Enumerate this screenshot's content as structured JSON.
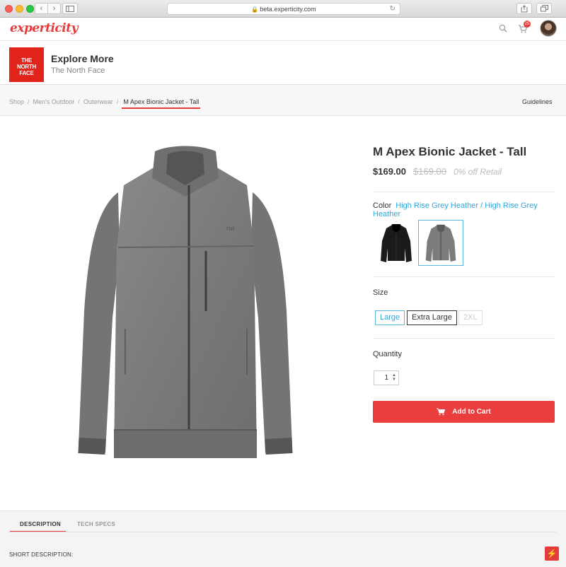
{
  "browser": {
    "url": "beta.experticity.com",
    "back_icon": "chevron-left-icon",
    "forward_icon": "chevron-right-icon"
  },
  "header": {
    "logo_text": "experticity",
    "cart_count": "25",
    "brand_color": "#e43c3c"
  },
  "brand": {
    "title": "Explore More",
    "subtitle": "The North Face",
    "logo_text": "THE NORTH FACE"
  },
  "breadcrumb": {
    "items": [
      "Shop",
      "Men's Outdoor",
      "Outerwear"
    ],
    "current": "M Apex Bionic Jacket - Tall",
    "guidelines_label": "Guidelines"
  },
  "product": {
    "title": "M Apex Bionic Jacket - Tall",
    "price": "$169.00",
    "retail_price": "$169.00",
    "discount": "0% off Retail",
    "color_label": "Color",
    "color_value": "High Rise Grey Heather / High Rise Grey Heather",
    "size_label": "Size",
    "sizes": [
      "Large",
      "Extra Large",
      "2XL"
    ],
    "selected_size": "Extra Large",
    "quantity_label": "Quantity",
    "quantity": "1",
    "add_to_cart_label": "Add to Cart"
  },
  "tabs": {
    "description": "DESCRIPTION",
    "tech_specs": "TECH SPECS",
    "short_description_label": "SHORT DESCRIPTION:"
  }
}
